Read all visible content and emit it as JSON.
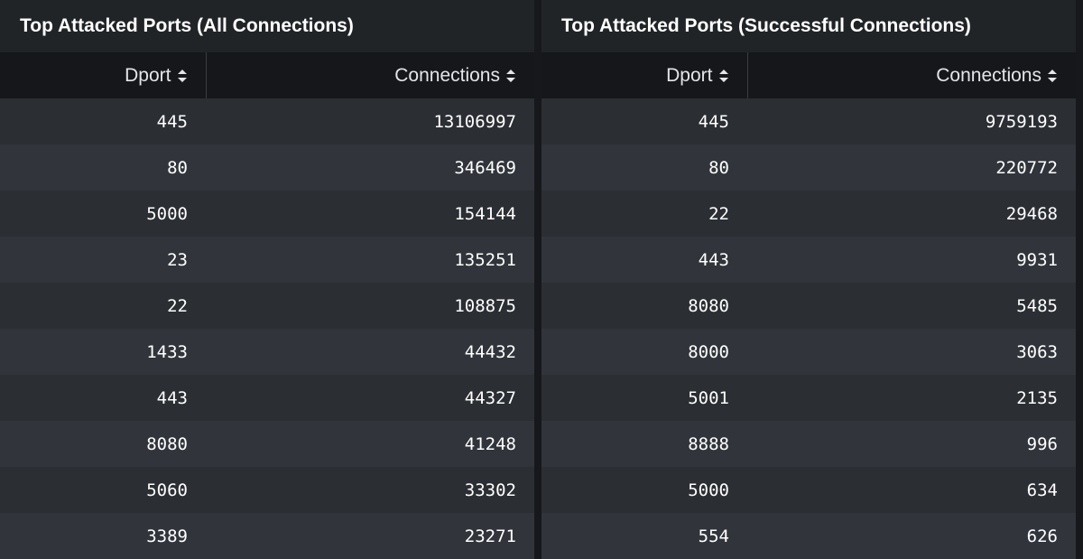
{
  "panels": [
    {
      "title": "Top Attacked Ports (All Connections)",
      "columns": [
        "Dport",
        "Connections"
      ],
      "rows": [
        {
          "dport": "445",
          "connections": "13106997"
        },
        {
          "dport": "80",
          "connections": "346469"
        },
        {
          "dport": "5000",
          "connections": "154144"
        },
        {
          "dport": "23",
          "connections": "135251"
        },
        {
          "dport": "22",
          "connections": "108875"
        },
        {
          "dport": "1433",
          "connections": "44432"
        },
        {
          "dport": "443",
          "connections": "44327"
        },
        {
          "dport": "8080",
          "connections": "41248"
        },
        {
          "dport": "5060",
          "connections": "33302"
        },
        {
          "dport": "3389",
          "connections": "23271"
        }
      ]
    },
    {
      "title": "Top Attacked Ports (Successful Connections)",
      "columns": [
        "Dport",
        "Connections"
      ],
      "rows": [
        {
          "dport": "445",
          "connections": "9759193"
        },
        {
          "dport": "80",
          "connections": "220772"
        },
        {
          "dport": "22",
          "connections": "29468"
        },
        {
          "dport": "443",
          "connections": "9931"
        },
        {
          "dport": "8080",
          "connections": "5485"
        },
        {
          "dport": "8000",
          "connections": "3063"
        },
        {
          "dport": "5001",
          "connections": "2135"
        },
        {
          "dport": "8888",
          "connections": "996"
        },
        {
          "dport": "5000",
          "connections": "634"
        },
        {
          "dport": "554",
          "connections": "626"
        }
      ]
    }
  ],
  "icons": {
    "sort": "sort-icon"
  },
  "colors": {
    "panel_bg": "#212427",
    "header_bg": "#15171a",
    "row_odd": "#2b2e33",
    "row_even": "#31353b",
    "text": "#ffffff"
  }
}
